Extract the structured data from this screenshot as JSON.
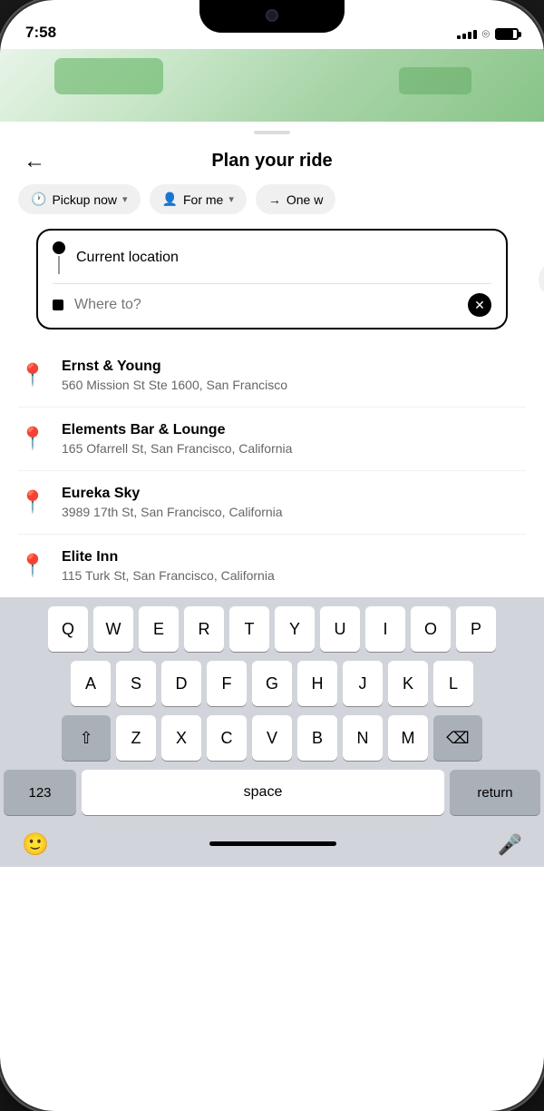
{
  "status": {
    "time": "7:58",
    "signal_bars": [
      4,
      6,
      8,
      10,
      12
    ],
    "battery_level": "80%"
  },
  "header": {
    "back_label": "←",
    "title": "Plan your ride"
  },
  "filters": [
    {
      "icon": "🕐",
      "label": "Pickup now",
      "arrow": "▾"
    },
    {
      "icon": "👤",
      "label": "For me",
      "arrow": "▾"
    },
    {
      "icon": "→",
      "label": "One w",
      "arrow": ""
    }
  ],
  "search": {
    "current_location": "Current location",
    "destination_placeholder": "Where to?",
    "add_stop_label": "+"
  },
  "results": [
    {
      "name": "Ernst & Young",
      "address": "560 Mission St Ste 1600, San Francisco"
    },
    {
      "name": "Elements Bar & Lounge",
      "address": "165 Ofarrell St, San Francisco, California"
    },
    {
      "name": "Eureka Sky",
      "address": "3989 17th St, San Francisco, California"
    },
    {
      "name": "Elite Inn",
      "address": "115 Turk St, San Francisco, California"
    }
  ],
  "keyboard": {
    "rows": [
      [
        "Q",
        "W",
        "E",
        "R",
        "T",
        "Y",
        "U",
        "I",
        "O",
        "P"
      ],
      [
        "A",
        "S",
        "D",
        "F",
        "G",
        "H",
        "J",
        "K",
        "L"
      ],
      [
        "Z",
        "X",
        "C",
        "V",
        "B",
        "N",
        "M"
      ]
    ],
    "space_label": "space",
    "return_label": "return",
    "num_label": "123"
  }
}
